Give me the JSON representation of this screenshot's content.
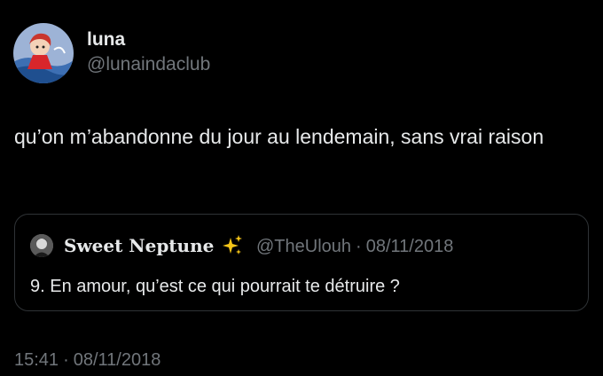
{
  "author": {
    "display_name": "luna",
    "handle": "@lunaindaclub",
    "avatar_icon": "anime-character-avatar"
  },
  "tweet": {
    "text": "qu’on m’abandonne du jour au lendemain, sans vrai raison"
  },
  "quoted_tweet": {
    "display_name": "Sweet Neptune",
    "emoji_icon": "sparkles-icon",
    "handle": "@TheUlouh",
    "separator": "·",
    "date": "08/11/2018",
    "text": "9. En amour, qu’est ce qui pourrait te détruire ?"
  },
  "meta": {
    "time": "15:41",
    "separator": "·",
    "date": "08/11/2018"
  },
  "colors": {
    "background": "#000000",
    "primary_text": "#e7e9ea",
    "secondary_text": "#71767b",
    "border": "#2f3336",
    "sparkle": "#f5c518"
  }
}
